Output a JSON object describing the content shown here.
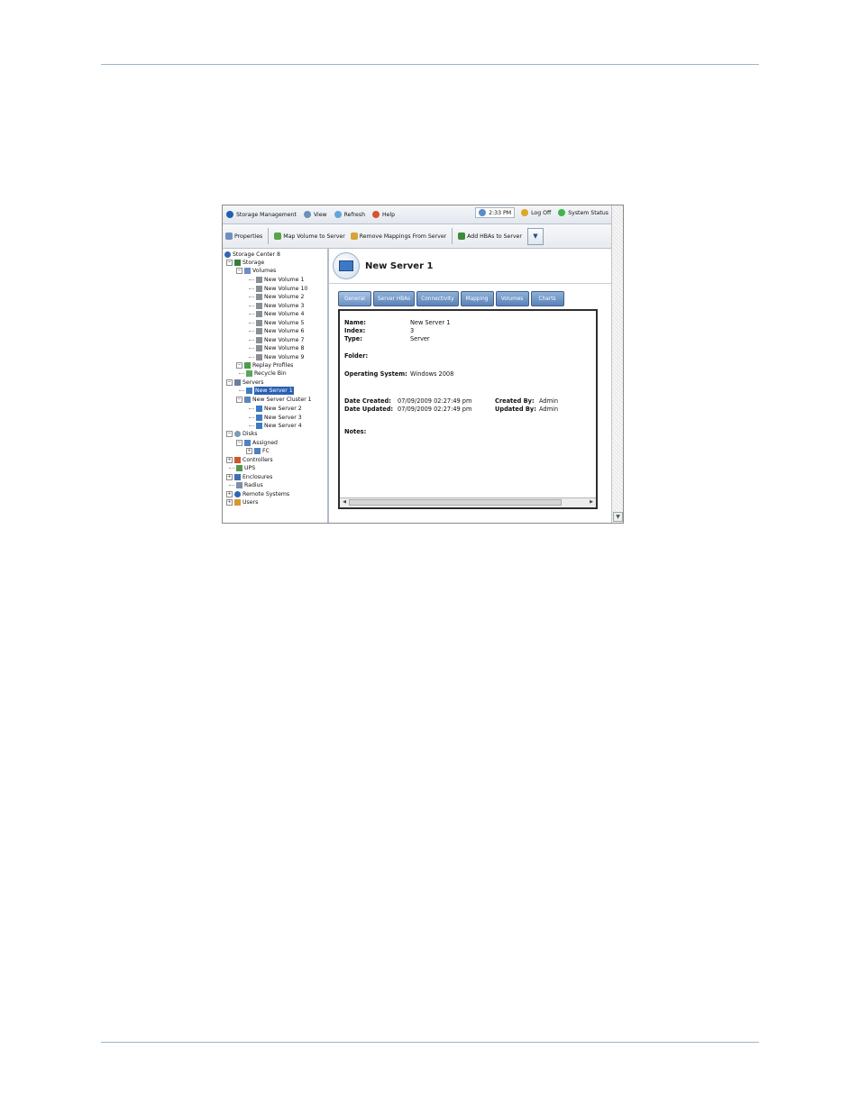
{
  "colors": {
    "rule": "#9fb6c6",
    "selection": "#2b5fb4",
    "tab": "#5a82b7"
  },
  "menubar": {
    "items": [
      {
        "label": "Storage Management",
        "icon": "storage-center-icon"
      },
      {
        "label": "View",
        "icon": "view-magnifier-icon"
      },
      {
        "label": "Refresh",
        "icon": "refresh-icon"
      },
      {
        "label": "Help",
        "icon": "help-icon"
      }
    ],
    "time": "2:33 PM",
    "logoff": "Log Off",
    "system_status": "System Status"
  },
  "toolbar": {
    "properties": "Properties",
    "map_volume": "Map Volume to Server",
    "remove_mappings": "Remove Mappings From Server",
    "add_hbas": "Add HBAs to Server",
    "dropdown": "▼"
  },
  "tree": {
    "root": "Storage Center 8",
    "storage": "Storage",
    "volumes": "Volumes",
    "volume_items": [
      "New Volume 1",
      "New Volume 10",
      "New Volume 2",
      "New Volume 3",
      "New Volume 4",
      "New Volume 5",
      "New Volume 6",
      "New Volume 7",
      "New Volume 8",
      "New Volume 9"
    ],
    "replay_profiles": "Replay Profiles",
    "recycle_bin": "Recycle Bin",
    "servers": "Servers",
    "server_selected": "New Server 1",
    "cluster": "New Server Cluster 1",
    "cluster_items": [
      "New Server 2",
      "New Server 3",
      "New Server 4"
    ],
    "disks": "Disks",
    "assigned": "Assigned",
    "fc": "FC",
    "controllers": "Controllers",
    "ups": "UPS",
    "enclosures": "Enclosures",
    "radius": "Radius",
    "remote_systems": "Remote Systems",
    "users": "Users"
  },
  "detail": {
    "title": "New Server 1",
    "tabs": [
      "General",
      "Server HBAs",
      "Connectivity",
      "Mapping",
      "Volumes",
      "Charts"
    ],
    "fields": {
      "name_label": "Name:",
      "name_value": "New Server 1",
      "index_label": "Index:",
      "index_value": "3",
      "type_label": "Type:",
      "type_value": "Server",
      "folder_label": "Folder:",
      "os_label": "Operating System:",
      "os_value": "Windows 2008",
      "created_label": "Date Created:",
      "created_value": "07/09/2009 02:27:49 pm",
      "updated_label": "Date Updated:",
      "updated_value": "07/09/2009 02:27:49 pm",
      "created_by_label": "Created By:",
      "created_by_value": "Admin",
      "updated_by_label": "Updated By:",
      "updated_by_value": "Admin",
      "notes_label": "Notes:"
    }
  }
}
